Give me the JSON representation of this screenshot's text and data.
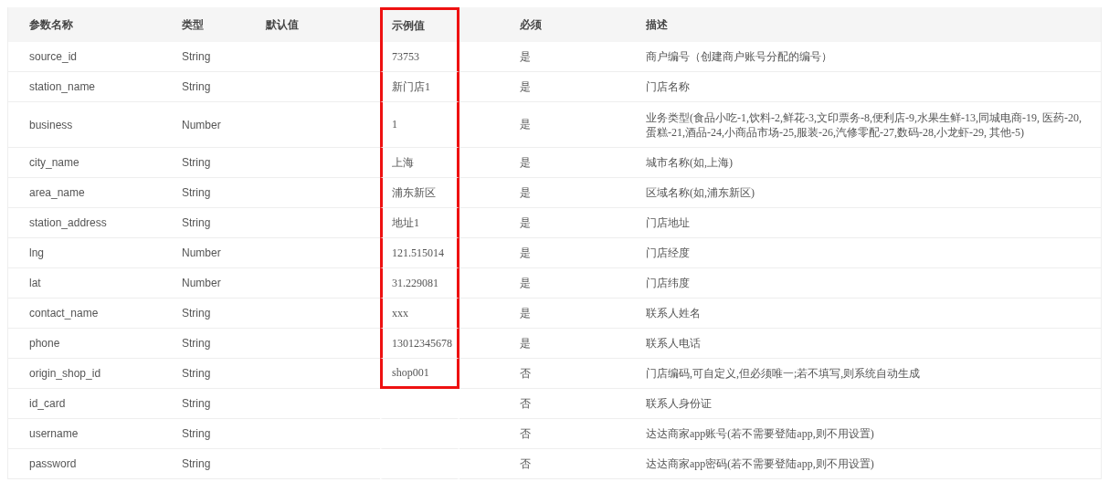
{
  "table": {
    "columns": [
      {
        "label": "参数名称",
        "highlighted": false
      },
      {
        "label": "类型",
        "highlighted": false
      },
      {
        "label": "默认值",
        "highlighted": false
      },
      {
        "label": "示例值",
        "highlighted": true
      },
      {
        "label": "必须",
        "highlighted": false
      },
      {
        "label": "描述",
        "highlighted": false
      }
    ],
    "rows": [
      {
        "name": "source_id",
        "type": "String",
        "example": "73753",
        "required": "是",
        "description": "商户编号（创建商户账号分配的编号）",
        "highlighted": true
      },
      {
        "name": "station_name",
        "type": "String",
        "example": "新门店1",
        "required": "是",
        "description": "门店名称",
        "highlighted": true
      },
      {
        "name": "business",
        "type": "Number",
        "example": "1",
        "required": "是",
        "description": "业务类型(食品小吃-1,饮料-2,鲜花-3,文印票务-8,便利店-9,水果生鲜-13,同城电商-19, 医药-20,蛋糕-21,酒品-24,小商品市场-25,服装-26,汽修零配-27,数码-28,小龙虾-29, 其他-5)",
        "highlighted": true
      },
      {
        "name": "city_name",
        "type": "String",
        "example": "上海",
        "required": "是",
        "description": "城市名称(如,上海)",
        "highlighted": true
      },
      {
        "name": "area_name",
        "type": "String",
        "example": "浦东新区",
        "required": "是",
        "description": "区域名称(如,浦东新区)",
        "highlighted": true
      },
      {
        "name": "station_address",
        "type": "String",
        "example": "地址1",
        "required": "是",
        "description": "门店地址",
        "highlighted": true
      },
      {
        "name": "lng",
        "type": "Number",
        "example": "121.515014",
        "required": "是",
        "description": "门店经度",
        "highlighted": true
      },
      {
        "name": "lat",
        "type": "Number",
        "example": "31.229081",
        "required": "是",
        "description": "门店纬度",
        "highlighted": true
      },
      {
        "name": "contact_name",
        "type": "String",
        "example": "xxx",
        "required": "是",
        "description": "联系人姓名",
        "highlighted": true
      },
      {
        "name": "phone",
        "type": "String",
        "example": "13012345678",
        "required": "是",
        "description": "联系人电话",
        "highlighted": true
      },
      {
        "name": "origin_shop_id",
        "type": "String",
        "example": "shop001",
        "required": "否",
        "description": "门店编码,可自定义,但必须唯一;若不填写,则系统自动生成",
        "highlighted": true
      },
      {
        "name": "id_card",
        "type": "String",
        "required": "否",
        "description": "联系人身份证",
        "highlighted": false
      },
      {
        "name": "username",
        "type": "String",
        "required": "否",
        "description": "达达商家app账号(若不需要登陆app,则不用设置)",
        "highlighted": false
      },
      {
        "name": "password",
        "type": "String",
        "required": "否",
        "description": "达达商家app密码(若不需要登陆app,则不用设置)",
        "highlighted": false
      }
    ]
  }
}
